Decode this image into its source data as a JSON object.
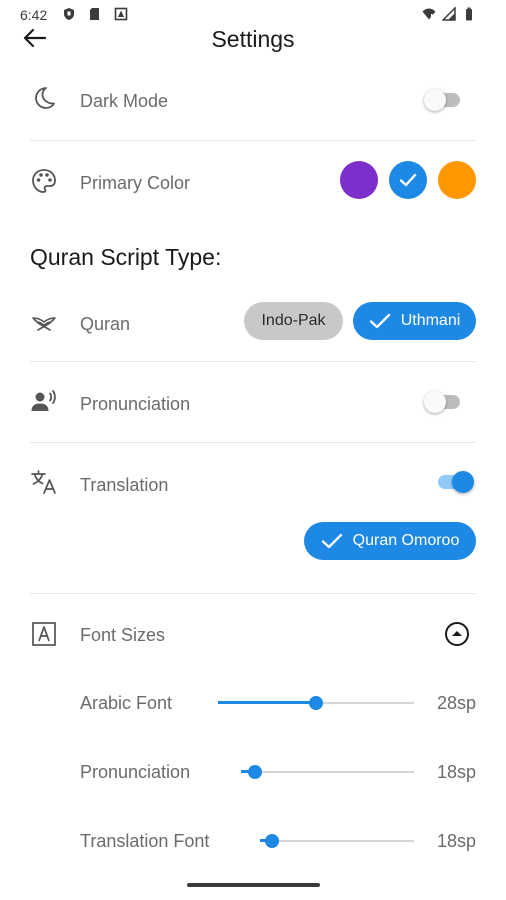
{
  "status_bar": {
    "time": "6:42",
    "left_icons": [
      "shield-icon",
      "sd-card-icon",
      "app-notification-icon"
    ],
    "right_icons": [
      "wifi-icon",
      "cell-signal-icon",
      "battery-icon"
    ]
  },
  "app_bar": {
    "back_icon": "arrow-back-icon",
    "title": "Settings"
  },
  "dark_mode": {
    "icon": "moon-icon",
    "label": "Dark Mode",
    "enabled": false
  },
  "primary_color": {
    "icon": "palette-icon",
    "label": "Primary Color",
    "options": [
      "#7b2fcb",
      "#1e88e5",
      "#ff9800"
    ],
    "selected_index": 1
  },
  "script_section": {
    "heading": "Quran Script Type:"
  },
  "quran": {
    "icon": "book-stand-icon",
    "label": "Quran",
    "options": [
      "Indo-Pak",
      "Uthmani"
    ],
    "selected": "Uthmani"
  },
  "pronunciation": {
    "icon": "speaking-person-icon",
    "label": "Pronunciation",
    "enabled": false
  },
  "translation": {
    "icon": "translate-icon",
    "label": "Translation",
    "enabled": true,
    "selected_translation": "Quran Omoroo"
  },
  "font_sizes": {
    "icon": "font-size-icon",
    "label": "Font Sizes",
    "collapse_icon": "chevron-up-circle-icon",
    "sliders": [
      {
        "label": "Arabic Font",
        "value": "28sp",
        "fraction": 0.5
      },
      {
        "label": "Pronunciation",
        "value": "18sp",
        "fraction": 0.08
      },
      {
        "label": "Translation Font",
        "value": "18sp",
        "fraction": 0.08
      }
    ]
  },
  "colors": {
    "accent": "#1e88e5",
    "purple": "#7b2fcb",
    "orange": "#ff9800",
    "label_gray": "#6b6b6b"
  }
}
